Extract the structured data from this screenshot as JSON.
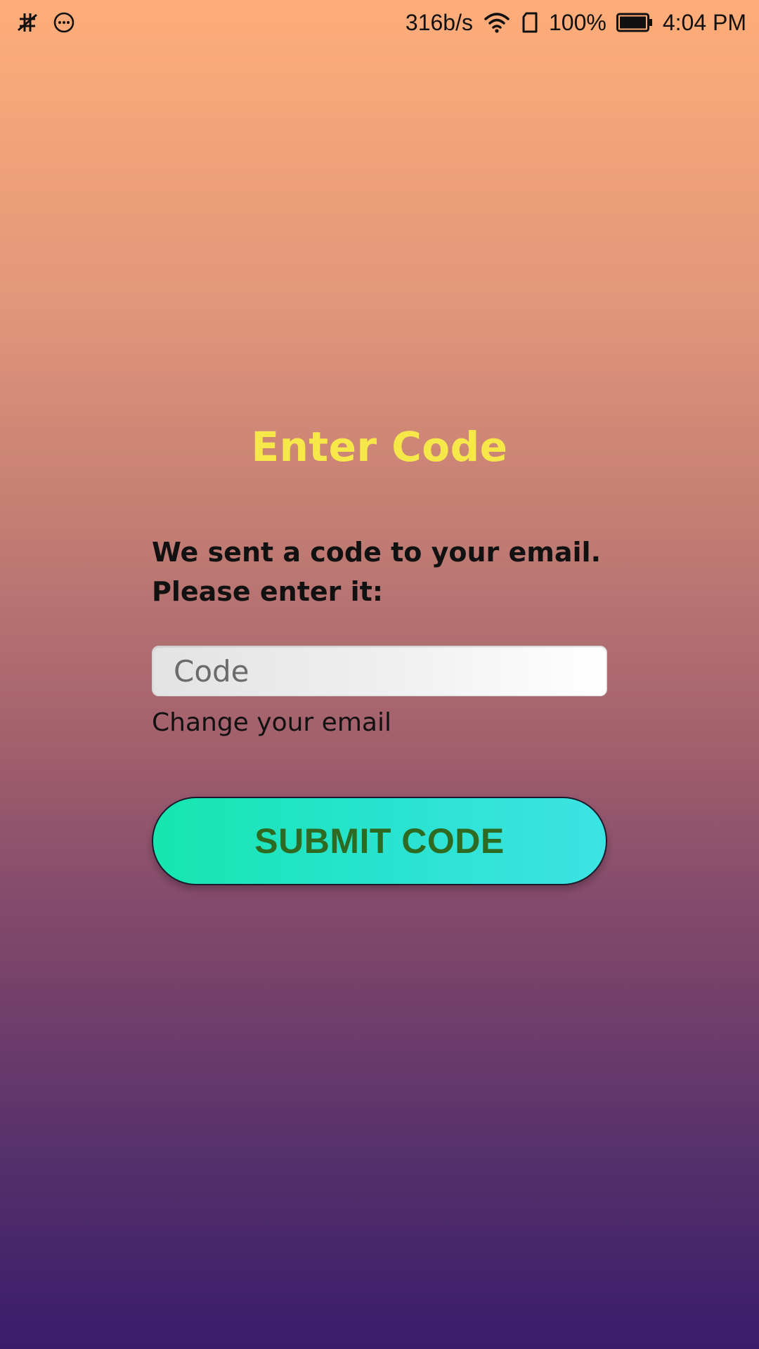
{
  "status_bar": {
    "left_icons": [
      "usb-debug-icon",
      "more-circle-icon"
    ],
    "network_speed": "316b/s",
    "battery_percent": "100%",
    "battery_level": 1.0,
    "time": "4:04 PM",
    "right_icons": [
      "wifi-icon",
      "sim-icon",
      "battery-icon"
    ]
  },
  "screen": {
    "title": "Enter Code",
    "message_line1": "We sent a code to your email.",
    "message_line2": "Please enter it:",
    "code_input": {
      "placeholder": "Code",
      "value": ""
    },
    "change_email_label": "Change your email",
    "submit_label": "SUBMIT CODE"
  },
  "colors": {
    "title": "#f7e84a",
    "submit_text": "#2f6a22",
    "submit_gradient_start": "#16e6af",
    "submit_gradient_end": "#3de3e4",
    "background_top": "#ffad79",
    "background_bottom": "#3b1b6b"
  }
}
